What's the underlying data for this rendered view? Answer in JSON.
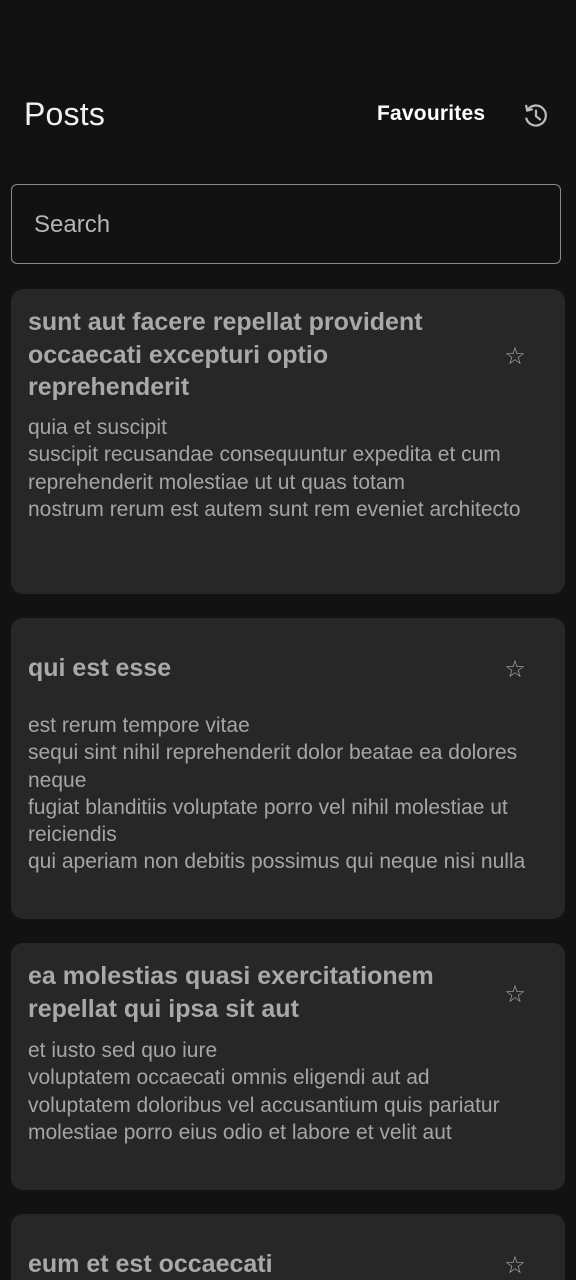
{
  "app_bar": {
    "title": "Posts",
    "favourites_label": "Favourites",
    "history_icon": "history-icon"
  },
  "search": {
    "placeholder": "Search",
    "value": ""
  },
  "posts": [
    {
      "title": "sunt aut facere repellat provident occaecati excepturi optio reprehenderit",
      "body": "quia et suscipit\nsuscipit recusandae consequuntur expedita et cum\nreprehenderit molestiae ut ut quas totam\nnostrum rerum est autem sunt rem eveniet architecto",
      "star_icon": "☆"
    },
    {
      "title": "qui est esse",
      "body": "est rerum tempore vitae\nsequi sint nihil reprehenderit dolor beatae ea dolores neque\nfugiat blanditiis voluptate porro vel nihil molestiae ut reiciendis\nqui aperiam non debitis possimus qui neque nisi nulla",
      "star_icon": "☆"
    },
    {
      "title": "ea molestias quasi exercitationem repellat qui ipsa sit aut",
      "body": "et iusto sed quo iure\nvoluptatem occaecati omnis eligendi aut ad\nvoluptatem doloribus vel accusantium quis pariatur\nmolestiae porro eius odio et labore et velit aut",
      "star_icon": "☆"
    },
    {
      "title": "eum et est occaecati",
      "body": "",
      "star_icon": "☆"
    }
  ],
  "colors": {
    "background": "#121212",
    "card": "#272727",
    "title_text": "#a9a9a9",
    "body_text": "#a5a5a5"
  }
}
